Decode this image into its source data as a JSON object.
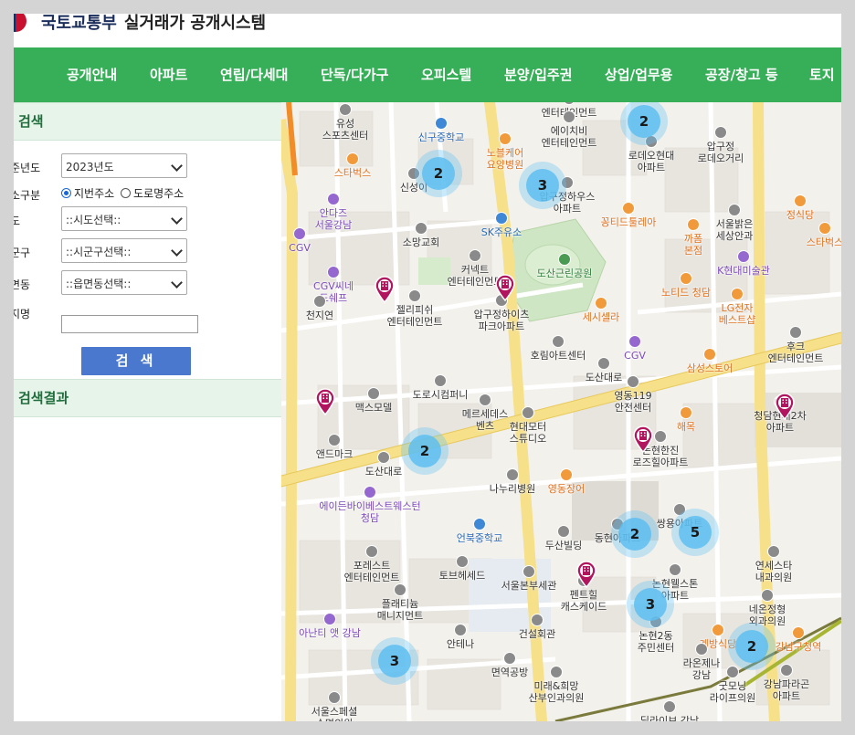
{
  "header": {
    "brand": "국토교통부",
    "system": "실거래가 공개시스템"
  },
  "nav": {
    "items": [
      "공개안내",
      "아파트",
      "연립/다세대",
      "단독/다가구",
      "오피스텔",
      "분양/입주권",
      "상업/업무용",
      "공장/창고 등",
      "토지"
    ]
  },
  "search": {
    "title": "검색",
    "year_label": "준년도",
    "year_value": "2023년도",
    "type_label": "소구분",
    "type_opt1": "지번주소",
    "type_opt2": "도로명주소",
    "sido_label": "도",
    "sido_value": "::시도선택::",
    "sigungu_label": "군구",
    "sigungu_value": "::시군구선택::",
    "dong_label": "면동",
    "dong_value": "::읍면동선택::",
    "jibun_label": "지명",
    "button": "검 색"
  },
  "results": {
    "title": "검색결과"
  },
  "map": {
    "clusters": [
      {
        "label": "2"
      },
      {
        "label": "2"
      },
      {
        "label": "3"
      },
      {
        "label": "2"
      },
      {
        "label": "2"
      },
      {
        "label": "5"
      },
      {
        "label": "3"
      },
      {
        "label": "2"
      },
      {
        "label": "3"
      }
    ],
    "pois": [
      {
        "text": "유성\n스포츠센터",
        "c": ""
      },
      {
        "text": "신구중학교",
        "c": "b"
      },
      {
        "text": "엔터테인먼트",
        "c": ""
      },
      {
        "text": "에이치비\n엔터테인먼트",
        "c": ""
      },
      {
        "text": "노블케어\n요양병원",
        "c": "o"
      },
      {
        "text": "신성이",
        "c": ""
      },
      {
        "text": "스타벅스",
        "c": "o"
      },
      {
        "text": "안다즈\n서울강남",
        "c": "p"
      },
      {
        "text": "소망교회",
        "c": ""
      },
      {
        "text": "SK주유소",
        "c": "b"
      },
      {
        "text": "압구정하우스\n아파트",
        "c": ""
      },
      {
        "text": "꽁티드툴레아",
        "c": "o"
      },
      {
        "text": "로데오현대\n아파트",
        "c": ""
      },
      {
        "text": "압구정\n로데오거리",
        "c": ""
      },
      {
        "text": "서울밝은\n세상안과",
        "c": ""
      },
      {
        "text": "CGV",
        "c": "p"
      },
      {
        "text": "도산근린공원",
        "c": "g"
      },
      {
        "text": "커넥트\n엔터테인먼트",
        "c": ""
      },
      {
        "text": "CGV씨네\n드쉐프",
        "c": "p"
      },
      {
        "text": "천지연",
        "c": ""
      },
      {
        "text": "젤리피쉬\n엔터테인먼트",
        "c": ""
      },
      {
        "text": "압구정하이츠\n파크아파트",
        "c": ""
      },
      {
        "text": "세시셀라",
        "c": "o"
      },
      {
        "text": "까폼\n본점",
        "c": "o"
      },
      {
        "text": "K현대미술관",
        "c": "p"
      },
      {
        "text": "노티드 청담",
        "c": "o"
      },
      {
        "text": "LG전자\n베스트샵",
        "c": "o"
      },
      {
        "text": "호림아트센터",
        "c": ""
      },
      {
        "text": "CGV",
        "c": "p"
      },
      {
        "text": "삼성스토어",
        "c": "o"
      },
      {
        "text": "후크\n엔터테인먼트",
        "c": ""
      },
      {
        "text": "도로시컴퍼니",
        "c": ""
      },
      {
        "text": "영동119\n안전센터",
        "c": ""
      },
      {
        "text": "맥스모델",
        "c": ""
      },
      {
        "text": "메르세데스\n벤츠",
        "c": ""
      },
      {
        "text": "해목",
        "c": "o"
      },
      {
        "text": "청담현대2차\n아파트",
        "c": ""
      },
      {
        "text": "앤드마크",
        "c": ""
      },
      {
        "text": "현대모터\n스튜디오",
        "c": ""
      },
      {
        "text": "논현한진\n로즈힐아파트",
        "c": ""
      },
      {
        "text": "나누리병원",
        "c": ""
      },
      {
        "text": "영동장어",
        "c": "o"
      },
      {
        "text": "에이든바이베스트웨스턴\n청담",
        "c": "p"
      },
      {
        "text": "언북중학교",
        "c": "b"
      },
      {
        "text": "두산빌딩",
        "c": ""
      },
      {
        "text": "동현아파트",
        "c": ""
      },
      {
        "text": "쌍용아파트",
        "c": ""
      },
      {
        "text": "포레스트\n엔터테인먼트",
        "c": ""
      },
      {
        "text": "토브헤세드",
        "c": ""
      },
      {
        "text": "서울본부세관",
        "c": ""
      },
      {
        "text": "펜트힐\n캐스케이드",
        "c": ""
      },
      {
        "text": "논현웰스톤\n아파트",
        "c": ""
      },
      {
        "text": "연세스타\n내과의원",
        "c": ""
      },
      {
        "text": "플래티늄\n매니지먼트",
        "c": ""
      },
      {
        "text": "아난티 앳 강남",
        "c": "p"
      },
      {
        "text": "건설회관",
        "c": ""
      },
      {
        "text": "안테나",
        "c": ""
      },
      {
        "text": "논현2동\n주민센터",
        "c": ""
      },
      {
        "text": "네온정형\n외과의원",
        "c": ""
      },
      {
        "text": "계방식당",
        "c": "o"
      },
      {
        "text": "면역공방",
        "c": ""
      },
      {
        "text": "라온제나\n강남",
        "c": ""
      },
      {
        "text": "강남구청역",
        "c": "o"
      },
      {
        "text": "미래&희망\n산부인과의원",
        "c": ""
      },
      {
        "text": "굿모닝\n라이프의원",
        "c": ""
      },
      {
        "text": "강남파라곤\n아파트",
        "c": ""
      },
      {
        "text": "서울스페셜\n수면의원",
        "c": ""
      },
      {
        "text": "딜라이브 강남",
        "c": ""
      },
      {
        "text": "도산대로",
        "c": ""
      },
      {
        "text": "도산대로",
        "c": ""
      },
      {
        "text": "정식당",
        "c": "o"
      },
      {
        "text": "스타벅스",
        "c": "o"
      }
    ]
  }
}
